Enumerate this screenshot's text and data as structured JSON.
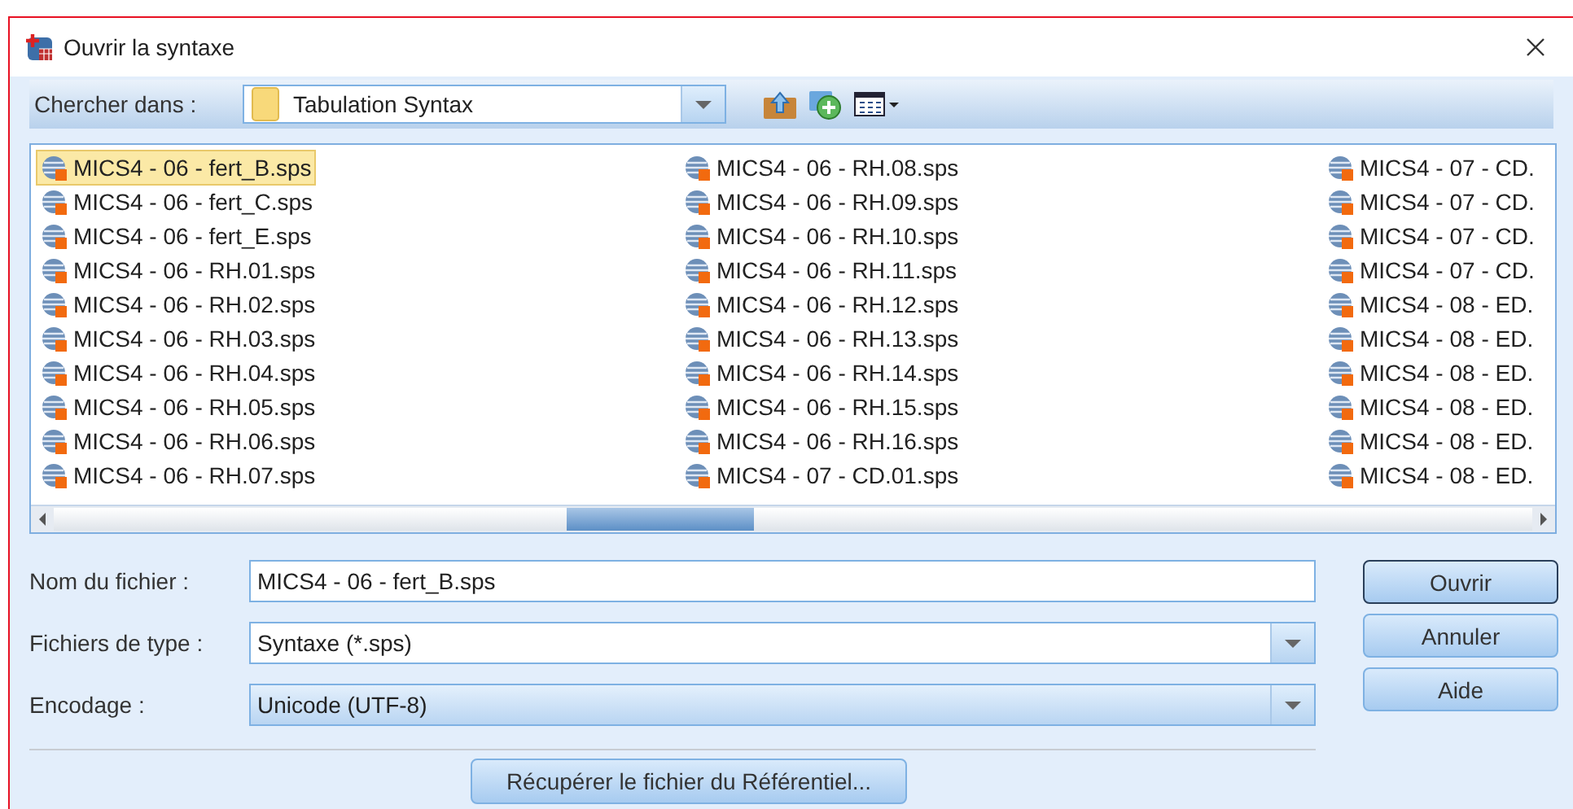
{
  "window": {
    "title": "Ouvrir la syntaxe"
  },
  "look_in": {
    "label": "Chercher dans :",
    "value": "Tabulation Syntax"
  },
  "files": [
    {
      "name": "MICS4 - 06 - fert_B.sps",
      "selected": true
    },
    {
      "name": "MICS4 - 06 - fert_C.sps",
      "selected": false
    },
    {
      "name": "MICS4 - 06 - fert_E.sps",
      "selected": false
    },
    {
      "name": "MICS4 - 06 - RH.01.sps",
      "selected": false
    },
    {
      "name": "MICS4 - 06 - RH.02.sps",
      "selected": false
    },
    {
      "name": "MICS4 - 06 - RH.03.sps",
      "selected": false
    },
    {
      "name": "MICS4 - 06 - RH.04.sps",
      "selected": false
    },
    {
      "name": "MICS4 - 06 - RH.05.sps",
      "selected": false
    },
    {
      "name": "MICS4 - 06 - RH.06.sps",
      "selected": false
    },
    {
      "name": "MICS4 - 06 - RH.07.sps",
      "selected": false
    },
    {
      "name": "MICS4 - 06 - RH.08.sps",
      "selected": false
    },
    {
      "name": "MICS4 - 06 - RH.09.sps",
      "selected": false
    },
    {
      "name": "MICS4 - 06 - RH.10.sps",
      "selected": false
    },
    {
      "name": "MICS4 - 06 - RH.11.sps",
      "selected": false
    },
    {
      "name": "MICS4 - 06 - RH.12.sps",
      "selected": false
    },
    {
      "name": "MICS4 - 06 - RH.13.sps",
      "selected": false
    },
    {
      "name": "MICS4 - 06 - RH.14.sps",
      "selected": false
    },
    {
      "name": "MICS4 - 06 - RH.15.sps",
      "selected": false
    },
    {
      "name": "MICS4 - 06 - RH.16.sps",
      "selected": false
    },
    {
      "name": "MICS4 - 07 - CD.01.sps",
      "selected": false
    },
    {
      "name": "MICS4 - 07 - CD.",
      "selected": false
    },
    {
      "name": "MICS4 - 07 - CD.",
      "selected": false
    },
    {
      "name": "MICS4 - 07 - CD.",
      "selected": false
    },
    {
      "name": "MICS4 - 07 - CD.",
      "selected": false
    },
    {
      "name": "MICS4 - 08 - ED.",
      "selected": false
    },
    {
      "name": "MICS4 - 08 - ED.",
      "selected": false
    },
    {
      "name": "MICS4 - 08 - ED.",
      "selected": false
    },
    {
      "name": "MICS4 - 08 - ED.",
      "selected": false
    },
    {
      "name": "MICS4 - 08 - ED.",
      "selected": false
    },
    {
      "name": "MICS4 - 08 - ED.",
      "selected": false
    }
  ],
  "fields": [
    {
      "kind": "text",
      "label": "Nom du fichier :",
      "value": "MICS4 - 06 - fert_B.sps"
    },
    {
      "kind": "dropdown",
      "label": "Fichiers de type :",
      "value": "Syntaxe (*.sps)"
    },
    {
      "kind": "combo",
      "label": "Encodage :",
      "value": "Unicode (UTF-8)"
    }
  ],
  "buttons": [
    {
      "label": "Ouvrir",
      "default": true
    },
    {
      "label": "Annuler",
      "default": false
    },
    {
      "label": "Aide",
      "default": false
    }
  ],
  "repository_button": "Récupérer le fichier du Référentiel..."
}
